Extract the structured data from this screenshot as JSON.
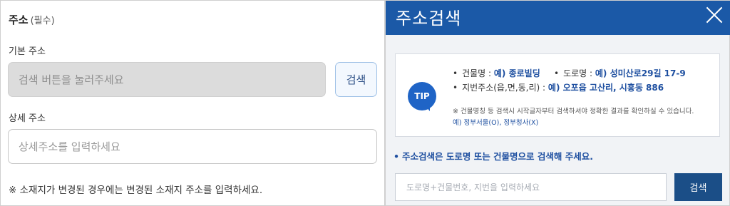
{
  "left": {
    "section_title": "주소",
    "section_required": "(필수)",
    "basic_label": "기본 주소",
    "basic_placeholder": "검색 버튼을 눌러주세요",
    "search_button": "검색",
    "detail_label": "상세 주소",
    "detail_placeholder": "상세주소를 입력하세요",
    "note": "※ 소재지가 변경된 경우에는 변경된 소재지 주소를 입력하세요."
  },
  "popup": {
    "title": "주소검색",
    "close_icon": "close-icon",
    "tip_badge": "TIP",
    "tip_lines": [
      {
        "label": "건물명 :",
        "example": "예) 종로빌딩"
      },
      {
        "label": "도로명 :",
        "example": "예) 성미산로29길 17-9"
      },
      {
        "label": "지번주소(읍,면,동,리) :",
        "example": "예) 오포읍 고산리, 시흥동 886"
      }
    ],
    "tip_note": "※ 건물명칭 등 검색시 시작글자부터 검색하셔야 정확한 결과를 확인하실 수 있습니다.",
    "tip_example": "예) 정부서울(O), 정부청사(X)",
    "guide": "주소검색은 도로명 또는 건물명으로 검색해 주세요.",
    "search_placeholder": "도로명+건물번호, 지번을 입력하세요",
    "search_button": "검색"
  },
  "colors": {
    "header_blue": "#1b59a7",
    "accent_text": "#1e4fa0",
    "search_button": "#1b4e87"
  }
}
